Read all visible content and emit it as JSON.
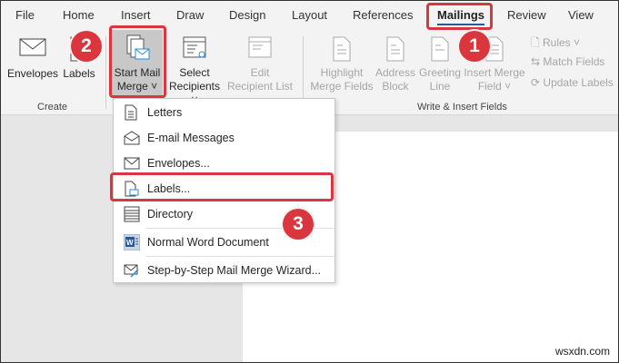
{
  "tabs": [
    "File",
    "Home",
    "Insert",
    "Draw",
    "Design",
    "Layout",
    "References",
    "Mailings",
    "Review",
    "View"
  ],
  "ribbon": {
    "envelopes": "Envelopes",
    "labels": "Labels",
    "start_mail_1": "Start Mail",
    "start_mail_2": "Merge ˅",
    "select_1": "Select",
    "select_2": "Recipients ˅",
    "edit_1": "Edit",
    "edit_2": "Recipient List",
    "highlight_1": "Highlight",
    "highlight_2": "Merge Fields",
    "address_1": "Address",
    "address_2": "Block",
    "greeting_1": "Greeting",
    "greeting_2": "Line",
    "insert_1": "Insert Merge",
    "insert_2": "Field ˅",
    "rules": "Rules ˅",
    "match": "Match Fields",
    "update": "Update Labels",
    "group_create": "Create",
    "group_write": "Write & Insert Fields"
  },
  "menu": [
    "Letters",
    "E-mail Messages",
    "Envelopes...",
    "Labels...",
    "Directory",
    "Normal Word Document",
    "Step-by-Step Mail Merge Wizard..."
  ],
  "badges": [
    "1",
    "2",
    "3"
  ],
  "watermark": "wsxdn.com",
  "colors": {
    "highlight": "#d9363e",
    "accent": "#2b579a"
  }
}
